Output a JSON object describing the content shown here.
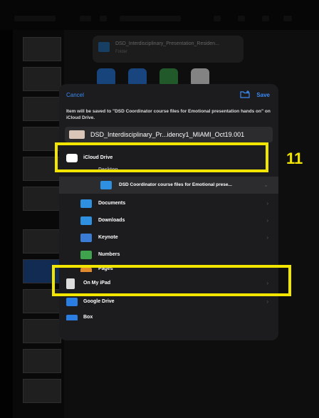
{
  "dialog": {
    "cancel_label": "Cancel",
    "save_label": "Save",
    "message": "Item will be saved to \"DSD Coordinator course files for Emotional presentation hands on\" on iCloud Drive.",
    "filename": "DSD_Interdisciplinary_Pr...idency1_MIAMI_Oct19.001"
  },
  "background": {
    "doc_title": "DSD_Interdisciplinary_Presentation_Residen...",
    "doc_subtitle": "Folder"
  },
  "locations": [
    {
      "label": "iCloud Drive",
      "icon": "cloud-icon",
      "highlighted": true
    },
    {
      "label": "Desktop",
      "icon": "folder-icon"
    },
    {
      "label": "DSD Coordinator course files for Emotional prese...",
      "icon": "folder-icon",
      "selected": true
    },
    {
      "label": "Documents",
      "icon": "folder-icon"
    },
    {
      "label": "Downloads",
      "icon": "folder-icon"
    },
    {
      "label": "Keynote",
      "icon": "keynote-icon"
    },
    {
      "label": "Numbers",
      "icon": "numbers-icon"
    },
    {
      "label": "Pages",
      "icon": "pages-icon"
    },
    {
      "label": "On My iPad",
      "icon": "ipad-icon",
      "highlighted": true
    },
    {
      "label": "Google Drive",
      "icon": "google-drive-icon"
    },
    {
      "label": "Box",
      "icon": "box-icon"
    }
  ],
  "step_number": "11",
  "colors": {
    "accent": "#3b8bf5",
    "highlight": "#f2e600",
    "folder": "#2f8fe0"
  }
}
